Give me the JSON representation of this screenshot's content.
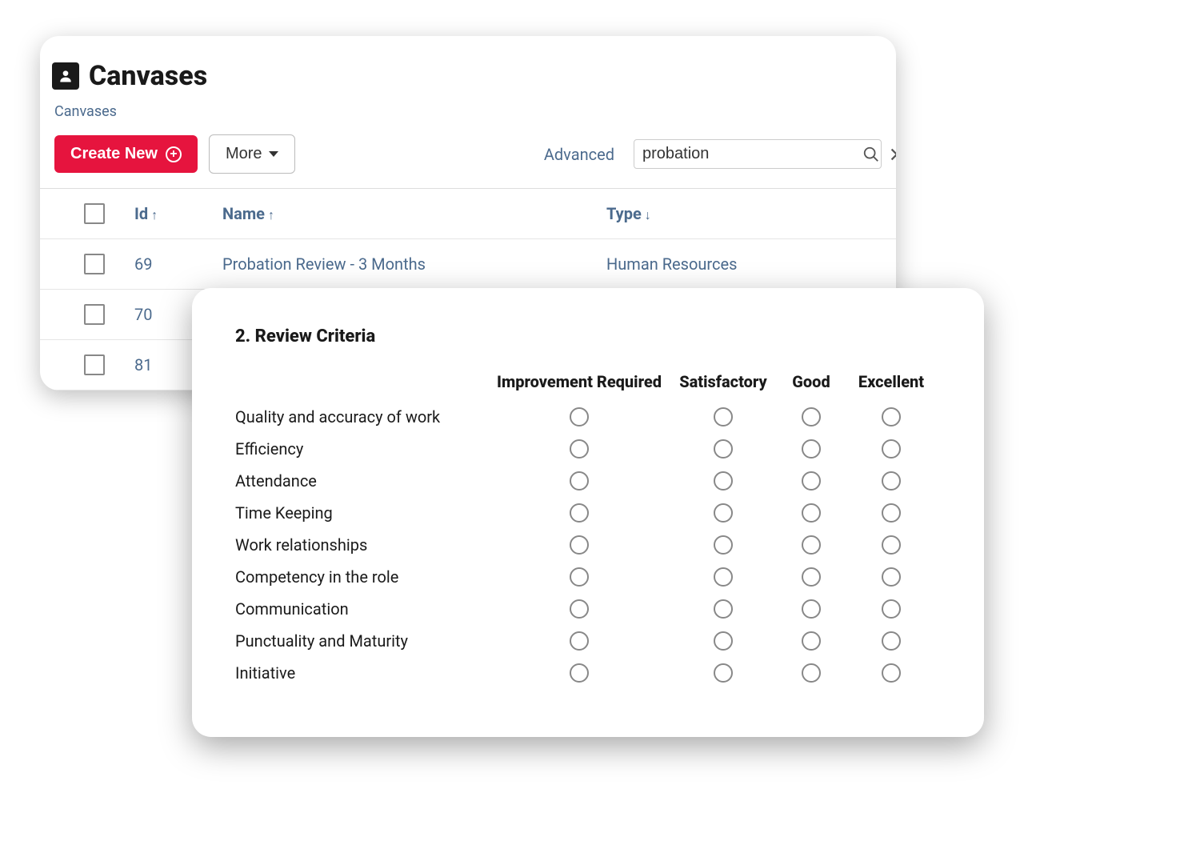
{
  "page": {
    "title": "Canvases",
    "breadcrumb": "Canvases"
  },
  "toolbar": {
    "create_label": "Create New",
    "more_label": "More",
    "advanced_label": "Advanced",
    "search_value": "probation"
  },
  "table": {
    "headers": {
      "id": "Id",
      "name": "Name",
      "type": "Type"
    },
    "rows": [
      {
        "id": "69",
        "name": "Probation Review - 3 Months",
        "type": "Human Resources"
      },
      {
        "id": "70",
        "name": "",
        "type": ""
      },
      {
        "id": "81",
        "name": "",
        "type": ""
      }
    ]
  },
  "review": {
    "section_title": "2. Review Criteria",
    "rating_headers": [
      "Improvement Required",
      "Satisfactory",
      "Good",
      "Excellent"
    ],
    "criteria": [
      "Quality and accuracy of work",
      "Efficiency",
      "Attendance",
      "Time Keeping",
      "Work relationships",
      "Competency in the role",
      "Communication",
      "Punctuality and Maturity",
      "Initiative"
    ]
  }
}
